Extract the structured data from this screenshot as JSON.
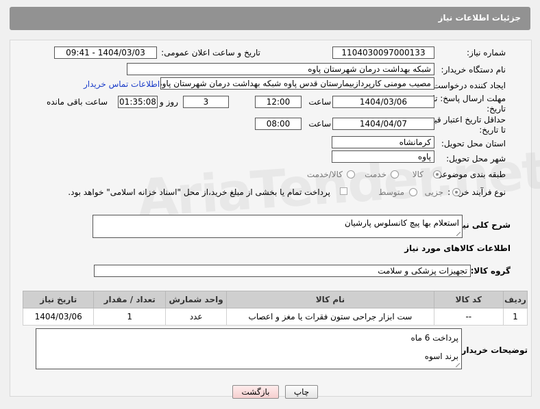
{
  "header": {
    "title": "جزئیات اطلاعات نیاز"
  },
  "form": {
    "need_number_label": "شماره نیاز:",
    "need_number": "1104030097000133",
    "announce_label": "تاریخ و ساعت اعلان عمومی:",
    "announce_value": "1404/03/03 - 09:41",
    "buyer_org_label": "نام دستگاه خریدار:",
    "buyer_org": "شبکه بهداشت درمان شهرستان پاوه",
    "requester_label": "ایجاد کننده درخواست:",
    "requester": "مصیب مومنی کارپردازبیمارستان قدس پاوه شبکه بهداشت درمان شهرستان پاوه",
    "contact_link": "اطلاعات تماس خریدار",
    "reply_deadline_label_1": "مهلت ارسال پاسخ: تا",
    "reply_deadline_label_2": "تاریخ:",
    "reply_date": "1404/03/06",
    "time_label": "ساعت",
    "reply_time": "12:00",
    "days_value": "3",
    "days_label": "روز و",
    "remaining_time": "01:35:08",
    "remaining_label": "ساعت باقی مانده",
    "price_validity_label_1": "حداقل تاریخ اعتبار قیمت:",
    "price_validity_label_2": "تا تاریخ:",
    "price_date": "1404/04/07",
    "price_time_label": "ساعت",
    "price_time": "08:00",
    "province_label": "استان محل تحویل:",
    "province": "کرمانشاه",
    "city_label": "شهر محل تحویل:",
    "city": "پاوه",
    "category_label": "طبقه بندی موضوعی:",
    "category_options": [
      "کالا",
      "خدمت",
      "کالا/خدمت"
    ],
    "category_selected": "کالا",
    "process_label": "نوع فرآیند خرید :",
    "process_options": [
      "جزیی",
      "متوسط"
    ],
    "process_selected": "جزیی",
    "payment_note": "پرداخت تمام یا بخشی از مبلغ خرید،از محل \"اسناد خزانه اسلامی\" خواهد بود."
  },
  "description": {
    "label": "شرح کلی نیاز:",
    "text": "استعلام بها پیچ کانسلوس پارشیان"
  },
  "goods_section": {
    "title": "اطلاعات کالاهای مورد نیاز",
    "group_label": "گروه کالا:",
    "group_value": "تجهیزات پزشکی و سلامت"
  },
  "table": {
    "columns": [
      "ردیف",
      "کد کالا",
      "نام کالا",
      "واحد شمارش",
      "تعداد / مقدار",
      "تاریخ نیاز"
    ],
    "rows": [
      [
        "1",
        "--",
        "ست ابزار جراحی ستون فقرات یا مغز و اعصاب",
        "عدد",
        "1",
        "1404/03/06"
      ]
    ]
  },
  "buyer_notes": {
    "label": "توضیحات خریدار:",
    "line1": "پرداخت 6 ماه",
    "line2": "برند اسوه"
  },
  "buttons": {
    "print": "چاپ",
    "back": "بازگشت"
  },
  "watermark": "AriaTender.net"
}
